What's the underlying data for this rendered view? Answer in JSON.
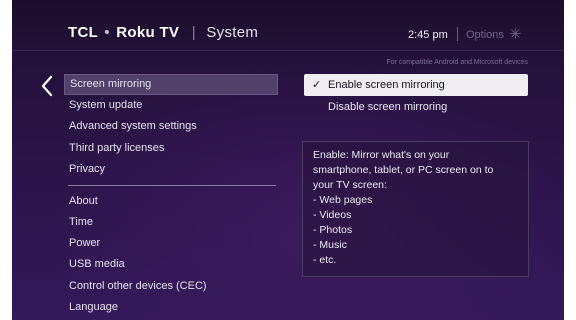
{
  "header": {
    "brand_tcl": "TCL",
    "brand_dot": "•",
    "brand_roku": "Roku TV",
    "divider": "|",
    "section": "System",
    "clock": "2:45 pm",
    "options_label": "Options",
    "options_icon": "✳"
  },
  "menu": {
    "items": [
      {
        "label": "Screen mirroring",
        "selected": true
      },
      {
        "label": "System update"
      },
      {
        "label": "Advanced system settings"
      },
      {
        "label": "Third party licenses"
      },
      {
        "label": "Privacy"
      },
      {
        "label": "About"
      },
      {
        "label": "Time"
      },
      {
        "label": "Power"
      },
      {
        "label": "USB media"
      },
      {
        "label": "Control other devices (CEC)"
      },
      {
        "label": "Language"
      }
    ]
  },
  "panel": {
    "compat_note": "For compatible Android and Microsoft devices",
    "options": [
      {
        "label": "Enable screen mirroring",
        "checked": true,
        "check_glyph": "✓"
      },
      {
        "label": "Disable screen mirroring",
        "checked": false
      }
    ],
    "description_lines": [
      "Enable: Mirror what's on your",
      "smartphone, tablet, or PC screen on to",
      "your TV screen:",
      "- Web pages",
      "- Videos",
      "- Photos",
      "- Music",
      "- etc."
    ]
  },
  "colors": {
    "background": "#2a1345",
    "selected_menu": "#514069",
    "selected_option": "#efedf1"
  }
}
